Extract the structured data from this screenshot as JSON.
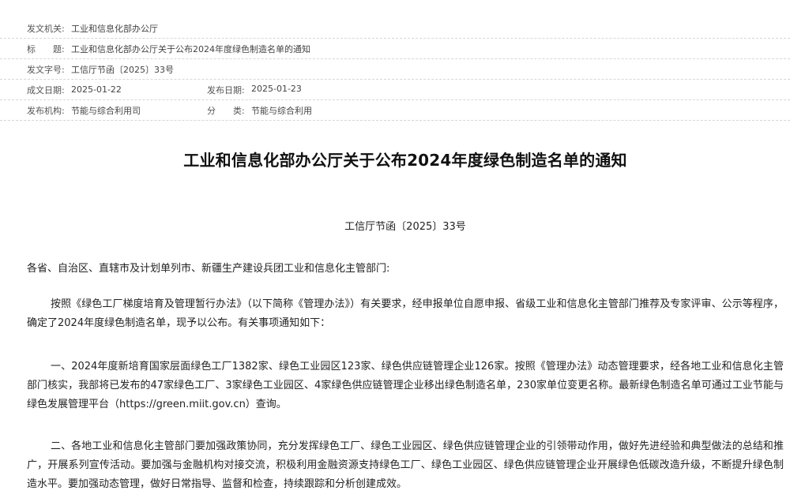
{
  "meta": {
    "issuer_label": "发文机关:",
    "issuer": "工业和信息化部办公厅",
    "title_label": "标　　题:",
    "title": "工业和信息化部办公厅关于公布2024年度绿色制造名单的通知",
    "docno_label": "发文字号:",
    "docno": "工信厅节函〔2025〕33号",
    "created_label": "成文日期:",
    "created": "2025-01-22",
    "published_label": "发布日期:",
    "published": "2025-01-23",
    "publisher_label": "发布机构:",
    "publisher": "节能与综合利用司",
    "category_label": "分　　类:",
    "category": "节能与综合利用"
  },
  "article": {
    "title": "工业和信息化部办公厅关于公布2024年度绿色制造名单的通知",
    "docno": "工信厅节函〔2025〕33号",
    "salutation": "各省、自治区、直辖市及计划单列市、新疆生产建设兵团工业和信息化主管部门:",
    "para1": "按照《绿色工厂梯度培育及管理暂行办法》（以下简称《管理办法》）有关要求，经申报单位自愿申报、省级工业和信息化主管部门推荐及专家评审、公示等程序，确定了2024年度绿色制造名单，现予以公布。有关事项通知如下：",
    "para2": "一、2024年度新培育国家层面绿色工厂1382家、绿色工业园区123家、绿色供应链管理企业126家。按照《管理办法》动态管理要求，经各地工业和信息化主管部门核实，我部将已发布的47家绿色工厂、3家绿色工业园区、4家绿色供应链管理企业移出绿色制造名单，230家单位变更名称。最新绿色制造名单可通过工业节能与绿色发展管理平台（https://green.miit.gov.cn）查询。",
    "para3": "二、各地工业和信息化主管部门要加强政策协同，充分发挥绿色工厂、绿色工业园区、绿色供应链管理企业的引领带动作用，做好先进经验和典型做法的总结和推广，开展系列宣传活动。要加强与金融机构对接交流，积极利用金融资源支持绿色工厂、绿色工业园区、绿色供应链管理企业开展绿色低碳改造升级，不断提升绿色制造水平。要加强动态管理，做好日常指导、监督和检查，持续跟踪和分析创建成效。"
  }
}
